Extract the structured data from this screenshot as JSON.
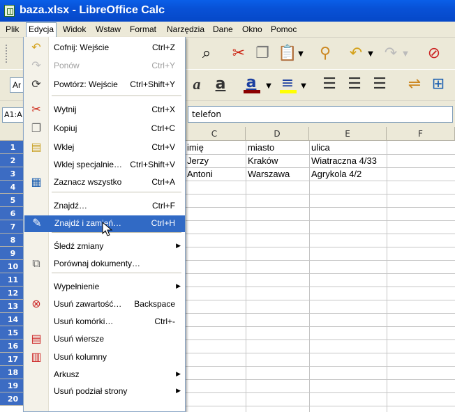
{
  "window": {
    "title": "baza.xlsx - LibreOffice Calc"
  },
  "menubar": [
    "Plik",
    "Edycja",
    "Widok",
    "Wstaw",
    "Format",
    "Narzędzia",
    "Dane",
    "Okno",
    "Pomoc"
  ],
  "namebox": "A1:A",
  "formula": "telefon",
  "columns": [
    "C",
    "D",
    "E",
    "F"
  ],
  "rows": [
    "1",
    "2",
    "3",
    "4",
    "5",
    "6",
    "7",
    "8",
    "9",
    "10",
    "11",
    "12",
    "13",
    "14",
    "15",
    "16",
    "17",
    "18",
    "19",
    "20"
  ],
  "cells": [
    [
      "imię",
      "miasto",
      "ulica",
      ""
    ],
    [
      "Jerzy",
      "Kraków",
      "Wiatraczna 4/33",
      ""
    ],
    [
      "Antoni",
      "Warszawa",
      "Agrykola 4/2",
      ""
    ]
  ],
  "toolbar": {
    "font_box": "Ar"
  },
  "menu": [
    {
      "label": "Cofnij: Wejście",
      "shortcut": "Ctrl+Z",
      "icon": "undo-icon"
    },
    {
      "label": "Ponów",
      "shortcut": "Ctrl+Y",
      "icon": "redo-icon",
      "disabled": true
    },
    {
      "label": "Powtórz: Wejście",
      "shortcut": "Ctrl+Shift+Y",
      "icon": "repeat-icon"
    },
    {
      "label": "Wytnij",
      "shortcut": "Ctrl+X",
      "icon": "scissors-icon"
    },
    {
      "label": "Kopiuj",
      "shortcut": "Ctrl+C",
      "icon": "copy-icon"
    },
    {
      "label": "Wklej",
      "shortcut": "Ctrl+V",
      "icon": "paste-icon"
    },
    {
      "label": "Wklej specjalnie…",
      "shortcut": "Ctrl+Shift+V",
      "icon": ""
    },
    {
      "label": "Zaznacz wszystko",
      "shortcut": "Ctrl+A",
      "icon": "select-all-icon"
    },
    {
      "label": "Znajdź…",
      "shortcut": "Ctrl+F",
      "icon": ""
    },
    {
      "label": "Znajdź i zamień…",
      "shortcut": "Ctrl+H",
      "icon": "find-replace-icon",
      "hover": true
    },
    {
      "label": "Śledź zmiany",
      "shortcut": "",
      "icon": "",
      "submenu": true
    },
    {
      "label": "Porównaj dokumenty…",
      "shortcut": "",
      "icon": "compare-icon"
    },
    {
      "label": "Wypełnienie",
      "shortcut": "",
      "icon": "",
      "submenu": true
    },
    {
      "label": "Usuń zawartość…",
      "shortcut": "Backspace",
      "icon": "delete-contents-icon"
    },
    {
      "label": "Usuń komórki…",
      "shortcut": "Ctrl+-",
      "icon": ""
    },
    {
      "label": "Usuń wiersze",
      "shortcut": "",
      "icon": "delete-rows-icon"
    },
    {
      "label": "Usuń kolumny",
      "shortcut": "",
      "icon": "delete-columns-icon"
    },
    {
      "label": "Arkusz",
      "shortcut": "",
      "icon": "",
      "submenu": true
    },
    {
      "label": "Usuń podział strony",
      "shortcut": "",
      "icon": "",
      "submenu": true
    }
  ],
  "colors": {
    "title": "#0a5fe8",
    "selection": "#316ac5",
    "row_header_selected": "#3c6cc3"
  }
}
